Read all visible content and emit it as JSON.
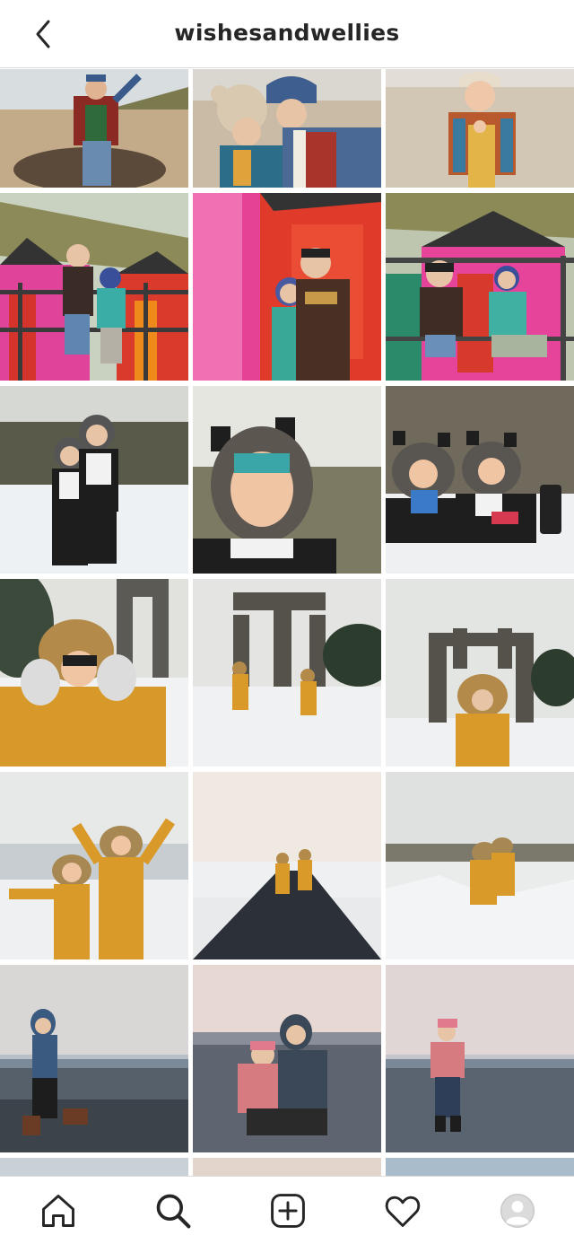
{
  "header": {
    "username": "wishesandwellies",
    "back_icon": "chevron-left-icon"
  },
  "grid": {
    "posts": [
      {
        "label": "boy-standing-on-log-beach"
      },
      {
        "label": "two-kids-beanies-nose-touch"
      },
      {
        "label": "girl-colorful-cardigan-beach"
      },
      {
        "label": "kids-on-railing-pink-beach-huts"
      },
      {
        "label": "two-boys-pink-red-huts"
      },
      {
        "label": "kids-hanging-on-railing-huts"
      },
      {
        "label": "two-kids-panda-snowsuits"
      },
      {
        "label": "child-fur-hood-closeup"
      },
      {
        "label": "kids-sitting-in-snow-panda-suits"
      },
      {
        "label": "child-mustard-coat-gloves"
      },
      {
        "label": "kids-running-abbey-ruins"
      },
      {
        "label": "child-throwing-snow-ruins"
      },
      {
        "label": "kids-arms-raised-snow"
      },
      {
        "label": "kids-walking-snowy-road"
      },
      {
        "label": "kids-walking-snowy-dunes"
      },
      {
        "label": "child-walking-beach-sunset"
      },
      {
        "label": "two-kids-crouching-shore"
      },
      {
        "label": "girl-pink-hat-beach"
      },
      {
        "label": "partial-post-1"
      },
      {
        "label": "partial-post-2"
      },
      {
        "label": "partial-post-3"
      }
    ]
  },
  "tabbar": {
    "items": [
      {
        "icon": "home-icon"
      },
      {
        "icon": "search-icon"
      },
      {
        "icon": "new-post-icon"
      },
      {
        "icon": "heart-icon"
      },
      {
        "icon": "profile-avatar-icon"
      }
    ]
  },
  "colors": {
    "border": "#dbdbdb",
    "text": "#262626",
    "icon": "#262626"
  }
}
